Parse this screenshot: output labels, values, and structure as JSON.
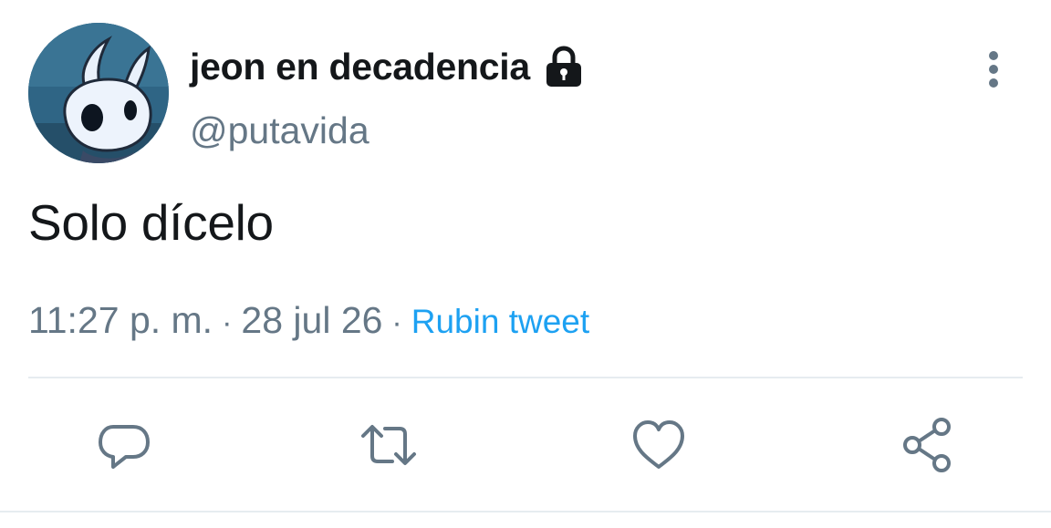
{
  "author": {
    "display_name": "jeon en decadencia",
    "handle": "@putavida",
    "protected_icon": "lock-icon",
    "avatar": "hollow-knight-avatar"
  },
  "tweet": {
    "text": "Solo dícelo"
  },
  "meta": {
    "time": "11:27 p. m.",
    "separator": "·",
    "date": "28 jul 26",
    "source": "Rubin tweet"
  },
  "actions": [
    {
      "name": "reply",
      "icon": "speech-bubble-icon"
    },
    {
      "name": "retweet",
      "icon": "retweet-arrows-icon"
    },
    {
      "name": "like",
      "icon": "heart-icon"
    },
    {
      "name": "share",
      "icon": "share-nodes-icon"
    }
  ],
  "colors": {
    "primary_text": "#14171a",
    "secondary_text": "#657786",
    "link": "#1da1f2",
    "divider": "#e6ecf0",
    "icon": "#657786"
  }
}
